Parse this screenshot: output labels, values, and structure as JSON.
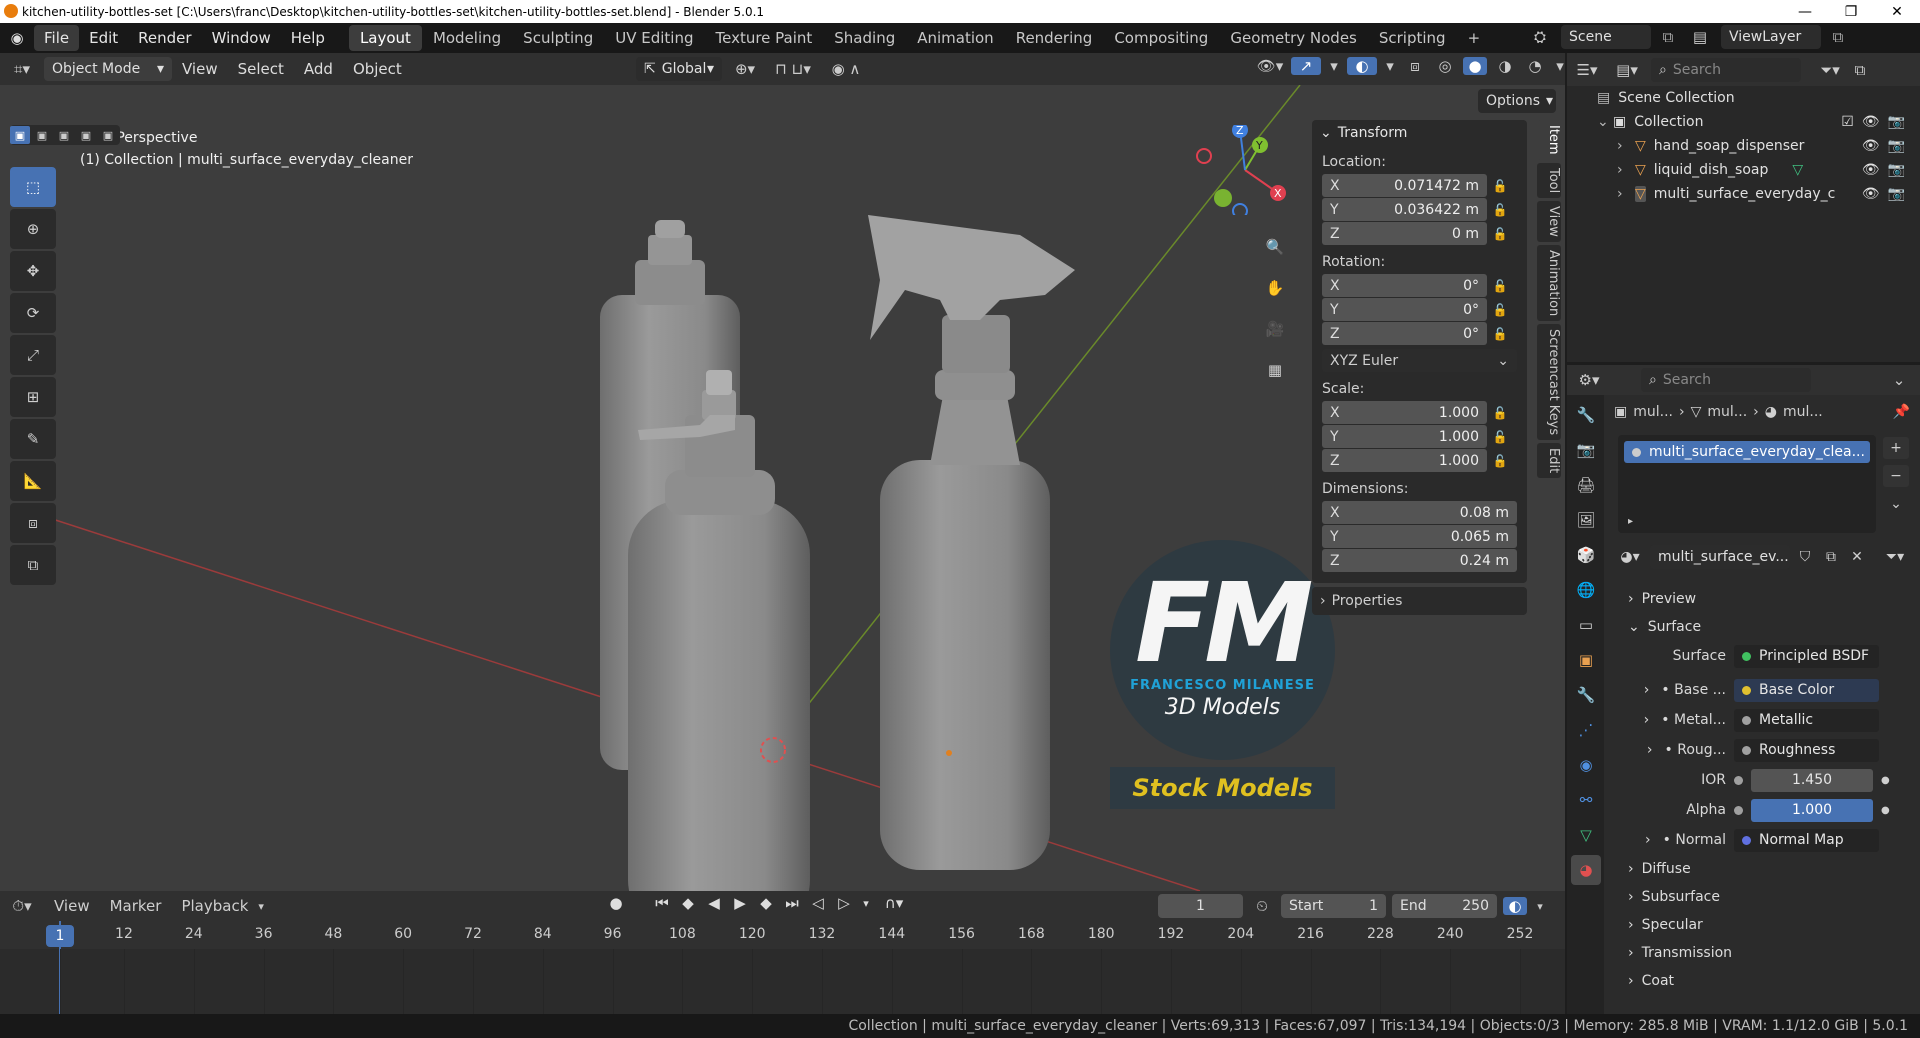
{
  "window": {
    "title": "kitchen-utility-bottles-set [C:\\Users\\franc\\Desktop\\kitchen-utility-bottles-set\\kitchen-utility-bottles-set.blend] - Blender 5.0.1",
    "minimize": "—",
    "maximize": "❐",
    "close": "✕"
  },
  "menu": [
    "File",
    "Edit",
    "Render",
    "Window",
    "Help"
  ],
  "workspaces": [
    "Layout",
    "Modeling",
    "Sculpting",
    "UV Editing",
    "Texture Paint",
    "Shading",
    "Animation",
    "Rendering",
    "Compositing",
    "Geometry Nodes",
    "Scripting"
  ],
  "workspace_add": "+",
  "scene": {
    "name": "Scene",
    "viewlayer": "ViewLayer"
  },
  "viewport_header": {
    "mode": "Object Mode",
    "menus": [
      "View",
      "Select",
      "Add",
      "Object"
    ],
    "orientation": "Global",
    "options": "Options"
  },
  "viewport": {
    "perspective": "User Perspective",
    "collection_line": "(1) Collection | multi_surface_everyday_cleaner"
  },
  "watermark": {
    "letters": "FM",
    "name": "FRANCESCO MILANESE",
    "sub": "3D Models",
    "banner": "Stock Models",
    "accent": "#1fa8e0"
  },
  "gizmo": {
    "x": "X",
    "y": "Y",
    "z": "Z"
  },
  "npanel": {
    "transform_title": "Transform",
    "location_label": "Location:",
    "location": [
      {
        "axis": "X",
        "value": "0.071472 m"
      },
      {
        "axis": "Y",
        "value": "0.036422 m"
      },
      {
        "axis": "Z",
        "value": "0 m"
      }
    ],
    "rotation_label": "Rotation:",
    "rotation": [
      {
        "axis": "X",
        "value": "0°"
      },
      {
        "axis": "Y",
        "value": "0°"
      },
      {
        "axis": "Z",
        "value": "0°"
      }
    ],
    "rotation_mode": "XYZ Euler",
    "scale_label": "Scale:",
    "scale": [
      {
        "axis": "X",
        "value": "1.000"
      },
      {
        "axis": "Y",
        "value": "1.000"
      },
      {
        "axis": "Z",
        "value": "1.000"
      }
    ],
    "dimensions_label": "Dimensions:",
    "dimensions": [
      {
        "axis": "X",
        "value": "0.08 m"
      },
      {
        "axis": "Y",
        "value": "0.065 m"
      },
      {
        "axis": "Z",
        "value": "0.24 m"
      }
    ],
    "properties_title": "Properties",
    "tabs": [
      "Item",
      "Tool",
      "View",
      "Animation",
      "Screencast Keys",
      "Edit"
    ]
  },
  "timeline": {
    "menus": [
      "View",
      "Marker",
      "Playback"
    ],
    "current_frame": "1",
    "start_label": "Start",
    "start": "1",
    "end_label": "End",
    "end": "250",
    "ruler": [
      "1",
      "12",
      "24",
      "36",
      "48",
      "60",
      "72",
      "84",
      "96",
      "108",
      "120",
      "132",
      "144",
      "156",
      "168",
      "180",
      "192",
      "204",
      "216",
      "228",
      "240",
      "252"
    ]
  },
  "status": {
    "text": "Collection | multi_surface_everyday_cleaner | Verts:69,313 | Faces:67,097 | Tris:134,194 | Objects:0/3 | Memory: 285.8 MiB | VRAM: 1.1/12.0 GiB | 5.0.1"
  },
  "outliner": {
    "search_placeholder": "Search",
    "scene_collection": "Scene Collection",
    "collection": "Collection",
    "objects": [
      "hand_soap_dispenser",
      "liquid_dish_soap",
      "multi_surface_everyday_c"
    ]
  },
  "properties": {
    "search_placeholder": "Search",
    "breadcrumb": [
      "mul...",
      "mul...",
      "mul..."
    ],
    "material_slot": "multi_surface_everyday_clea...",
    "material_name": "multi_surface_ev...",
    "preview": "Preview",
    "surface_section": "Surface",
    "surface_label": "Surface",
    "surface_value": "Principled BSDF",
    "rows": [
      {
        "label": "Base ...",
        "value": "Base Color",
        "color": "#e0c030"
      },
      {
        "label": "Metal...",
        "value": "Metallic",
        "color": "#a0a0a0"
      },
      {
        "label": "Roug...",
        "value": "Roughness",
        "color": "#a0a0a0"
      }
    ],
    "ior_label": "IOR",
    "ior": "1.450",
    "alpha_label": "Alpha",
    "alpha": "1.000",
    "normal_label": "Normal",
    "normal_value": "Normal Map",
    "sections": [
      "Diffuse",
      "Subsurface",
      "Specular",
      "Transmission",
      "Coat"
    ]
  }
}
